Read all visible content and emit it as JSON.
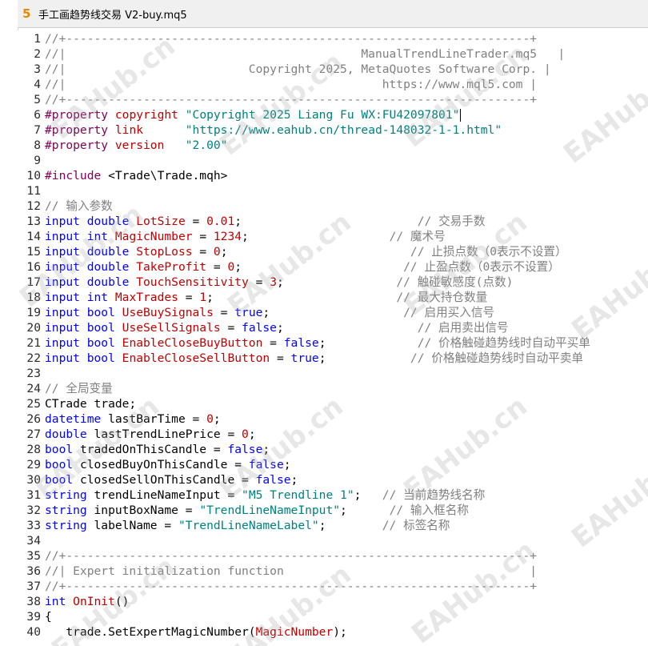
{
  "window": {
    "title": "手工画趋势线交易 V2-buy.mq5",
    "icon": "mq5-file-icon"
  },
  "colors": {
    "keyword": "#0000ff",
    "string": "#008080",
    "comment": "#808080",
    "identifier": "#c00000",
    "number": "#c00000",
    "plain": "#000000"
  },
  "watermark": "EAHub.cn",
  "lines": [
    {
      "n": "1",
      "tokens": [
        {
          "c": "com",
          "t": "//+------------------------------------------------------------------+"
        }
      ]
    },
    {
      "n": "2",
      "tokens": [
        {
          "c": "com",
          "t": "//|                                          ManualTrendLineTrader.mq5   |"
        }
      ]
    },
    {
      "n": "3",
      "tokens": [
        {
          "c": "com",
          "t": "//|                          Copyright 2025, MetaQuotes Software Corp. |"
        }
      ]
    },
    {
      "n": "4",
      "tokens": [
        {
          "c": "com",
          "t": "//|                                             https://www.mql5.com |"
        }
      ]
    },
    {
      "n": "5",
      "tokens": [
        {
          "c": "com",
          "t": "//+------------------------------------------------------------------+"
        }
      ]
    },
    {
      "n": "6",
      "tokens": [
        {
          "c": "pp",
          "t": "#property "
        },
        {
          "c": "id",
          "t": "copyright"
        },
        {
          "c": "pl",
          "t": " "
        },
        {
          "c": "str",
          "t": "\"Copyright 2025 Liang Fu WX:FU42097801\""
        }
      ],
      "cursor": true
    },
    {
      "n": "7",
      "tokens": [
        {
          "c": "pp",
          "t": "#property "
        },
        {
          "c": "id",
          "t": "link"
        },
        {
          "c": "pl",
          "t": "      "
        },
        {
          "c": "str",
          "t": "\"https://www.eahub.cn/thread-148032-1-1.html\""
        }
      ]
    },
    {
      "n": "8",
      "tokens": [
        {
          "c": "pp",
          "t": "#property "
        },
        {
          "c": "id",
          "t": "version"
        },
        {
          "c": "pl",
          "t": "   "
        },
        {
          "c": "str",
          "t": "\"2.00\""
        }
      ]
    },
    {
      "n": "9",
      "tokens": []
    },
    {
      "n": "10",
      "tokens": [
        {
          "c": "pp",
          "t": "#include "
        },
        {
          "c": "pl",
          "t": "<Trade\\Trade.mqh>"
        }
      ]
    },
    {
      "n": "11",
      "tokens": []
    },
    {
      "n": "12",
      "tokens": [
        {
          "c": "com",
          "t": "// 输入参数"
        }
      ]
    },
    {
      "n": "13",
      "tokens": [
        {
          "c": "kw",
          "t": "input double "
        },
        {
          "c": "id",
          "t": "LotSize"
        },
        {
          "c": "pl",
          "t": " = "
        },
        {
          "c": "num",
          "t": "0.01"
        },
        {
          "c": "pl",
          "t": ";                         "
        },
        {
          "c": "com",
          "t": "// 交易手数"
        }
      ]
    },
    {
      "n": "14",
      "tokens": [
        {
          "c": "kw",
          "t": "input int "
        },
        {
          "c": "id",
          "t": "MagicNumber"
        },
        {
          "c": "pl",
          "t": " = "
        },
        {
          "c": "num",
          "t": "1234"
        },
        {
          "c": "pl",
          "t": ";                    "
        },
        {
          "c": "com",
          "t": "// 魔术号"
        }
      ]
    },
    {
      "n": "15",
      "tokens": [
        {
          "c": "kw",
          "t": "input double "
        },
        {
          "c": "id",
          "t": "StopLoss"
        },
        {
          "c": "pl",
          "t": " = "
        },
        {
          "c": "num",
          "t": "0"
        },
        {
          "c": "pl",
          "t": ";                          "
        },
        {
          "c": "com",
          "t": "// 止损点数（0表示不设置）"
        }
      ]
    },
    {
      "n": "16",
      "tokens": [
        {
          "c": "kw",
          "t": "input double "
        },
        {
          "c": "id",
          "t": "TakeProfit"
        },
        {
          "c": "pl",
          "t": " = "
        },
        {
          "c": "num",
          "t": "0"
        },
        {
          "c": "pl",
          "t": ";                       "
        },
        {
          "c": "com",
          "t": "// 止盈点数（0表示不设置）"
        }
      ]
    },
    {
      "n": "17",
      "tokens": [
        {
          "c": "kw",
          "t": "input double "
        },
        {
          "c": "id",
          "t": "TouchSensitivity"
        },
        {
          "c": "pl",
          "t": " = "
        },
        {
          "c": "num",
          "t": "3"
        },
        {
          "c": "pl",
          "t": ";                "
        },
        {
          "c": "com",
          "t": "// 触碰敏感度(点数)"
        }
      ]
    },
    {
      "n": "18",
      "tokens": [
        {
          "c": "kw",
          "t": "input int "
        },
        {
          "c": "id",
          "t": "MaxTrades"
        },
        {
          "c": "pl",
          "t": " = "
        },
        {
          "c": "num",
          "t": "1"
        },
        {
          "c": "pl",
          "t": ";                          "
        },
        {
          "c": "com",
          "t": "// 最大持仓数量"
        }
      ]
    },
    {
      "n": "19",
      "tokens": [
        {
          "c": "kw",
          "t": "input bool "
        },
        {
          "c": "id",
          "t": "UseBuySignals"
        },
        {
          "c": "pl",
          "t": " = "
        },
        {
          "c": "kw",
          "t": "true"
        },
        {
          "c": "pl",
          "t": ";                   "
        },
        {
          "c": "com",
          "t": "// 启用买入信号"
        }
      ]
    },
    {
      "n": "20",
      "tokens": [
        {
          "c": "kw",
          "t": "input bool "
        },
        {
          "c": "id",
          "t": "UseSellSignals"
        },
        {
          "c": "pl",
          "t": " = "
        },
        {
          "c": "kw",
          "t": "false"
        },
        {
          "c": "pl",
          "t": ";                   "
        },
        {
          "c": "com",
          "t": "// 启用卖出信号"
        }
      ]
    },
    {
      "n": "21",
      "tokens": [
        {
          "c": "kw",
          "t": "input bool "
        },
        {
          "c": "id",
          "t": "EnableCloseBuyButton"
        },
        {
          "c": "pl",
          "t": " = "
        },
        {
          "c": "kw",
          "t": "false"
        },
        {
          "c": "pl",
          "t": ";             "
        },
        {
          "c": "com",
          "t": "// 价格触碰趋势线时自动平买单"
        }
      ]
    },
    {
      "n": "22",
      "tokens": [
        {
          "c": "kw",
          "t": "input bool "
        },
        {
          "c": "id",
          "t": "EnableCloseSellButton"
        },
        {
          "c": "pl",
          "t": " = "
        },
        {
          "c": "kw",
          "t": "true"
        },
        {
          "c": "pl",
          "t": ";            "
        },
        {
          "c": "com",
          "t": "// 价格触碰趋势线时自动平卖单"
        }
      ]
    },
    {
      "n": "23",
      "tokens": []
    },
    {
      "n": "24",
      "tokens": [
        {
          "c": "com",
          "t": "// 全局变量"
        }
      ]
    },
    {
      "n": "25",
      "tokens": [
        {
          "c": "pl",
          "t": "CTrade trade;"
        }
      ]
    },
    {
      "n": "26",
      "tokens": [
        {
          "c": "kw",
          "t": "datetime "
        },
        {
          "c": "pl",
          "t": "lastBarTime = "
        },
        {
          "c": "num",
          "t": "0"
        },
        {
          "c": "pl",
          "t": ";"
        }
      ]
    },
    {
      "n": "27",
      "tokens": [
        {
          "c": "kw",
          "t": "double "
        },
        {
          "c": "pl",
          "t": "lastTrendLinePrice = "
        },
        {
          "c": "num",
          "t": "0"
        },
        {
          "c": "pl",
          "t": ";"
        }
      ]
    },
    {
      "n": "28",
      "tokens": [
        {
          "c": "kw",
          "t": "bool "
        },
        {
          "c": "pl",
          "t": "tradedOnThisCandle = "
        },
        {
          "c": "kw",
          "t": "false"
        },
        {
          "c": "pl",
          "t": ";"
        }
      ]
    },
    {
      "n": "29",
      "tokens": [
        {
          "c": "kw",
          "t": "bool "
        },
        {
          "c": "pl",
          "t": "closedBuyOnThisCandle = "
        },
        {
          "c": "kw",
          "t": "false"
        },
        {
          "c": "pl",
          "t": ";"
        }
      ]
    },
    {
      "n": "30",
      "tokens": [
        {
          "c": "kw",
          "t": "bool "
        },
        {
          "c": "pl",
          "t": "closedSellOnThisCandle = "
        },
        {
          "c": "kw",
          "t": "false"
        },
        {
          "c": "pl",
          "t": ";"
        }
      ]
    },
    {
      "n": "31",
      "tokens": [
        {
          "c": "kw",
          "t": "string "
        },
        {
          "c": "pl",
          "t": "trendLineNameInput = "
        },
        {
          "c": "str",
          "t": "\"M5 Trendline 1\""
        },
        {
          "c": "pl",
          "t": ";   "
        },
        {
          "c": "com",
          "t": "// 当前趋势线名称"
        }
      ]
    },
    {
      "n": "32",
      "tokens": [
        {
          "c": "kw",
          "t": "string "
        },
        {
          "c": "pl",
          "t": "inputBoxName = "
        },
        {
          "c": "str",
          "t": "\"TrendLineNameInput\""
        },
        {
          "c": "pl",
          "t": ";      "
        },
        {
          "c": "com",
          "t": "// 输入框名称"
        }
      ]
    },
    {
      "n": "33",
      "tokens": [
        {
          "c": "kw",
          "t": "string "
        },
        {
          "c": "pl",
          "t": "labelName = "
        },
        {
          "c": "str",
          "t": "\"TrendLineNameLabel\""
        },
        {
          "c": "pl",
          "t": ";        "
        },
        {
          "c": "com",
          "t": "// 标签名称"
        }
      ]
    },
    {
      "n": "34",
      "tokens": []
    },
    {
      "n": "35",
      "tokens": [
        {
          "c": "com",
          "t": "//+------------------------------------------------------------------+"
        }
      ]
    },
    {
      "n": "36",
      "tokens": [
        {
          "c": "com",
          "t": "//| Expert initialization function                                   |"
        }
      ]
    },
    {
      "n": "37",
      "tokens": [
        {
          "c": "com",
          "t": "//+------------------------------------------------------------------+"
        }
      ]
    },
    {
      "n": "38",
      "tokens": [
        {
          "c": "kw",
          "t": "int "
        },
        {
          "c": "id",
          "t": "OnInit"
        },
        {
          "c": "pl",
          "t": "()"
        }
      ]
    },
    {
      "n": "39",
      "tokens": [
        {
          "c": "pl",
          "t": "{"
        }
      ]
    },
    {
      "n": "40",
      "tokens": [
        {
          "c": "pl",
          "t": "   trade.SetExpertMagicNumber("
        },
        {
          "c": "id",
          "t": "MagicNumber"
        },
        {
          "c": "pl",
          "t": ");"
        }
      ]
    }
  ]
}
